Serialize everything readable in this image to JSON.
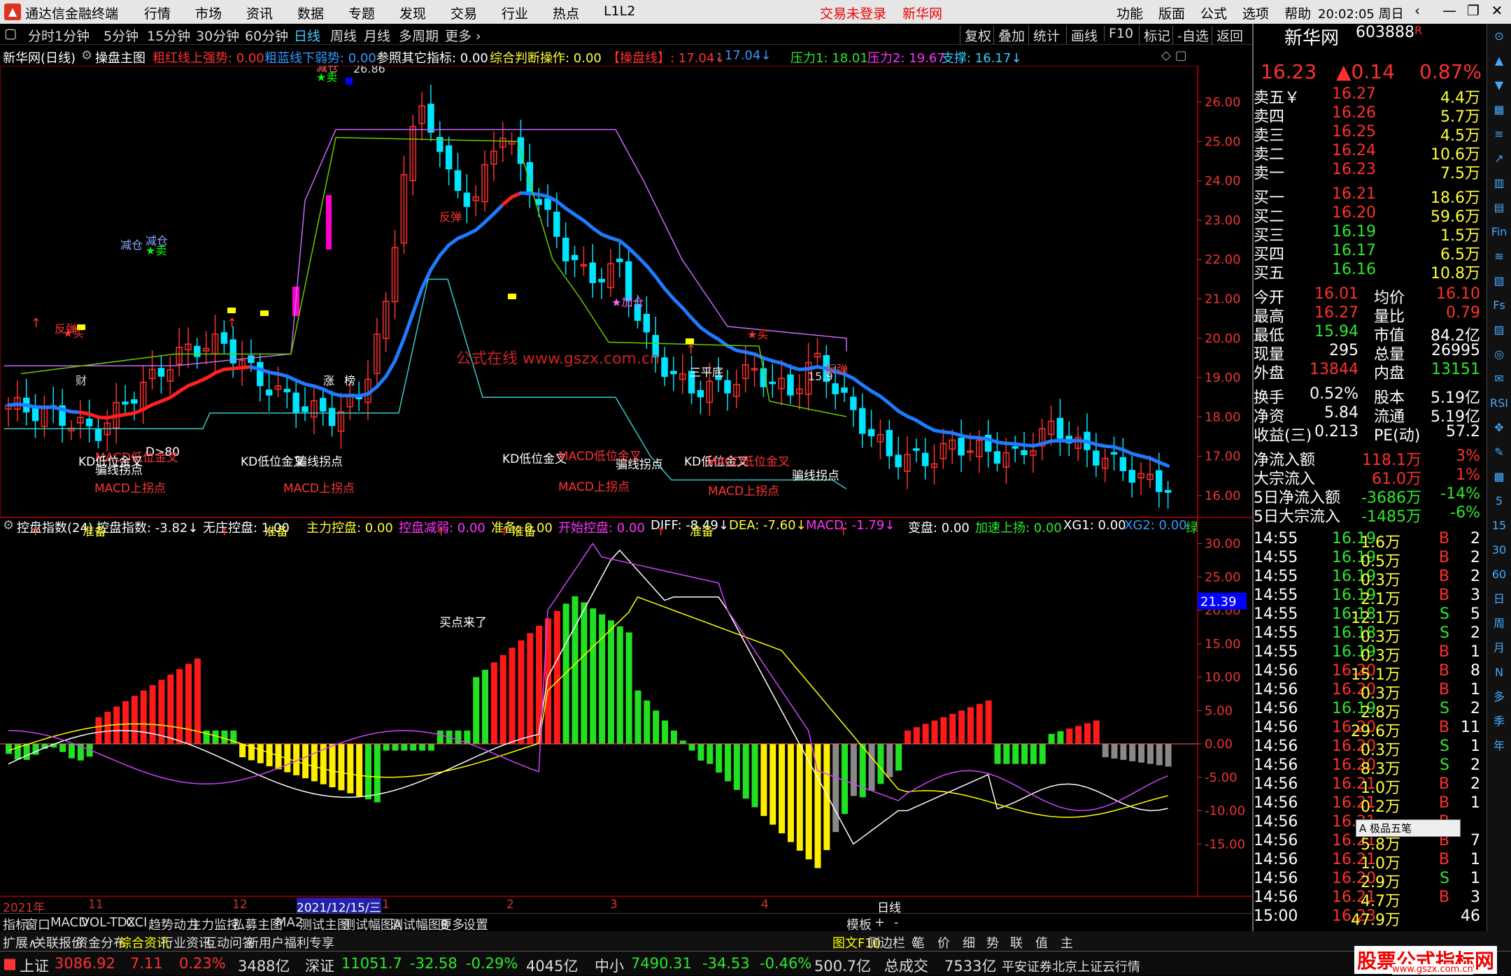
{
  "app": {
    "title": "通达信金融终端",
    "menu": [
      "行情",
      "市场",
      "资讯",
      "数据",
      "专题",
      "发现",
      "交易",
      "行业",
      "热点",
      "L1L2"
    ],
    "trade_status": "交易未登录",
    "corp": "新华网",
    "right_menu": [
      "功能",
      "版面",
      "公式",
      "选项",
      "帮助"
    ],
    "time": "20:02:05",
    "weekday": "周日",
    "win_buttons": [
      "‹",
      "—",
      "❐",
      "✕"
    ]
  },
  "period_bar": {
    "items": [
      "分时",
      "1分钟",
      "5分钟",
      "15分钟",
      "30分钟",
      "60分钟",
      "日线",
      "周线",
      "月线",
      "多周期",
      "更多 ›"
    ],
    "selected": "日线",
    "right_buttons": [
      "复权",
      "叠加",
      "统计",
      "画线",
      "F10",
      "标记",
      "-自选",
      "返回"
    ]
  },
  "main_header": {
    "stock": "新华网(日线)",
    "formula": "操盘主图",
    "items": [
      {
        "t": "粗红线上强势: 0.00",
        "c": "red"
      },
      {
        "t": "粗蓝线下弱势: 0.00",
        "c": "blu"
      },
      {
        "t": "参照其它指标: 0.00",
        "c": "wht"
      },
      {
        "t": "综合判断操作: 0.00",
        "c": "yel"
      },
      {
        "t": "【操盘线】: 17.04↓",
        "c": "red"
      },
      {
        "t": ": 17.04↓",
        "c": "blu"
      },
      {
        "t": "压力1: 18.01",
        "c": "grn"
      },
      {
        "t": "压力2: 19.67",
        "c": "mag"
      },
      {
        "t": "支撑: 16.17↓",
        "c": "cyan"
      }
    ]
  },
  "ind_header": {
    "name": "控盘指数(24)",
    "items": [
      {
        "t": "控盘指数: -3.82↓",
        "c": "wht"
      },
      {
        "t": "无庄控盘: 1.00",
        "c": "wht"
      },
      {
        "t": "主力控盘: 0.00",
        "c": "yel"
      },
      {
        "t": "控盘减弱: 0.00",
        "c": "mag"
      },
      {
        "t": "准备: 0.00",
        "c": "yel"
      },
      {
        "t": "开始控盘: 0.00",
        "c": "mag"
      },
      {
        "t": "DIFF: -8.49↓",
        "c": "wht"
      },
      {
        "t": "DEA: -7.60↓",
        "c": "yel"
      },
      {
        "t": "MACD: -1.79↓",
        "c": "mag"
      },
      {
        "t": "变盘: 0.00",
        "c": "wht"
      },
      {
        "t": "加速上扬: 0.00",
        "c": "grn"
      },
      {
        "t": "XG1: 0.00",
        "c": "wht"
      },
      {
        "t": "XG2: 0.00",
        "c": "blu"
      },
      {
        "t": "绿",
        "c": "grn"
      }
    ]
  },
  "price_axis": [
    "26.00",
    "25.00",
    "24.00",
    "23.00",
    "22.00",
    "21.00",
    "20.00",
    "19.00",
    "18.00",
    "17.00",
    "16.00"
  ],
  "ind_axis": [
    "30.00",
    "25.00",
    "20.00",
    "15.00",
    "10.00",
    "5.00",
    "0.00",
    "-5.00",
    "-10.00",
    "-15.00"
  ],
  "ind_current": "21.39",
  "price_annotations": [
    {
      "t": "减仓",
      "c": "#f66"
    },
    {
      "t": "★卖",
      "c": "#0f0"
    },
    {
      "t": "26.86",
      "c": "#ddd"
    },
    {
      "t": "减仓",
      "c": "#8af"
    },
    {
      "t": "减仓",
      "c": "#8af"
    },
    {
      "t": "★卖",
      "c": "#0f0"
    },
    {
      "t": "反弹",
      "c": "#f33"
    },
    {
      "t": "反弹",
      "c": "#f33"
    },
    {
      "t": "★买",
      "c": "#f33"
    },
    {
      "t": "★加仓",
      "c": "#f6f"
    },
    {
      "t": "★买",
      "c": "#f33"
    },
    {
      "t": "三平底",
      "c": "#fff"
    },
    {
      "t": "15.9",
      "c": "#ddd"
    },
    {
      "t": "反弹",
      "c": "#f33"
    },
    {
      "t": "财",
      "c": "#ddd"
    },
    {
      "t": "涨",
      "c": "#fff"
    },
    {
      "t": "榜",
      "c": "#fff"
    },
    {
      "t": "公式在线  www.gszx.com.cn",
      "c": "#c22"
    }
  ],
  "ind_annotations": [
    {
      "t": "D>80",
      "c": "#fff"
    },
    {
      "t": "MACD低位金叉",
      "c": "#f33"
    },
    {
      "t": "KD低位金叉",
      "c": "#fff"
    },
    {
      "t": "骗线拐点",
      "c": "#fff"
    },
    {
      "t": "MACD上拐点",
      "c": "#f33"
    },
    {
      "t": "准备",
      "c": "#ff3"
    },
    {
      "t": "KD低位金叉",
      "c": "#fff"
    },
    {
      "t": "骗线拐点",
      "c": "#fff"
    },
    {
      "t": "MACD上拐点",
      "c": "#f33"
    },
    {
      "t": "准备",
      "c": "#ff3"
    },
    {
      "t": "买点来了",
      "c": "#fff"
    },
    {
      "t": "KD低位金叉",
      "c": "#fff"
    },
    {
      "t": "MACD低位金叉",
      "c": "#f33"
    },
    {
      "t": "骗线拐点",
      "c": "#fff"
    },
    {
      "t": "MACD上拐点",
      "c": "#f33"
    },
    {
      "t": "准备",
      "c": "#ff3"
    },
    {
      "t": "KD低位金叉",
      "c": "#fff"
    },
    {
      "t": "MACD低位金叉",
      "c": "#f33"
    },
    {
      "t": "MACD上拐点",
      "c": "#f33"
    },
    {
      "t": "骗线拐点",
      "c": "#fff"
    },
    {
      "t": "准备",
      "c": "#ff3"
    }
  ],
  "x_axis": [
    "2021年",
    "11",
    "12",
    "2021/12/15/三",
    "1",
    "2",
    "3",
    "4",
    "日线"
  ],
  "tabs_bottom": [
    "指标",
    "窗口",
    "MACD",
    "VOL-TDX",
    "CCI",
    "趋势动力",
    "主力监控",
    "私募主图",
    "MA2",
    "测试主图",
    "测试幅图A",
    "测试幅图B",
    "更多",
    "设置",
    "模板",
    "+",
    "-"
  ],
  "tabs_info": [
    "扩展∧",
    "关联报价",
    "资金分布",
    "综合资讯",
    "行业资讯",
    "互动问答",
    "新用户福利专享",
    "图文F10",
    "侧边栏《",
    "笔",
    "价",
    "细",
    "势",
    "联",
    "值",
    "主"
  ],
  "status": {
    "sh_label": "上证",
    "sh_val": "3086.92",
    "sh_chg": "7.11",
    "sh_pct": "0.23%",
    "sh_amt": "3488亿",
    "sz_label": "深证",
    "sz_val": "11051.7",
    "sz_chg": "-32.58",
    "sz_pct": "-0.29%",
    "sz_amt": "4045亿",
    "zx_label": "中小",
    "zx_val": "7490.31",
    "zx_chg": "-34.53",
    "zx_pct": "-0.46%",
    "zx_amt": "500.7亿",
    "total_label": "总成交",
    "total_val": "7533亿",
    "server": "平安证券北京上证云行情",
    "logo": "股票公式指标网",
    "logo_url": "www.gszx.com.cn"
  },
  "quote": {
    "name": "新华网",
    "code": "603888",
    "flag": "R",
    "price": "16.23",
    "chg": "▲0.14",
    "pct": "0.87%",
    "asks": [
      {
        "l": "卖五￥",
        "p": "16.27",
        "v": "4.4万"
      },
      {
        "l": "卖四",
        "p": "16.26",
        "v": "5.7万"
      },
      {
        "l": "卖三",
        "p": "16.25",
        "v": "4.5万"
      },
      {
        "l": "卖二",
        "p": "16.24",
        "v": "10.6万"
      },
      {
        "l": "卖一",
        "p": "16.23",
        "v": "7.5万"
      }
    ],
    "bids": [
      {
        "l": "买一",
        "p": "16.21",
        "v": "18.6万"
      },
      {
        "l": "买二",
        "p": "16.20",
        "v": "59.6万"
      },
      {
        "l": "买三",
        "p": "16.19",
        "v": "1.5万"
      },
      {
        "l": "买四",
        "p": "16.17",
        "v": "6.5万"
      },
      {
        "l": "买五",
        "p": "16.16",
        "v": "10.8万"
      }
    ],
    "stats": [
      {
        "a": "今开",
        "b": "16.01",
        "ac": "red",
        "c": "均价",
        "d": "16.10",
        "dc": "red"
      },
      {
        "a": "最高",
        "b": "16.27",
        "ac": "red",
        "c": "量比",
        "d": "0.79",
        "dc": "red"
      },
      {
        "a": "最低",
        "b": "15.94",
        "ac": "grn",
        "c": "市值",
        "d": "84.2亿",
        "dc": "wht"
      },
      {
        "a": "现量",
        "b": "295",
        "ac": "wht",
        "c": "总量",
        "d": "26995",
        "dc": "wht"
      },
      {
        "a": "外盘",
        "b": "13844",
        "ac": "red",
        "c": "内盘",
        "d": "13151",
        "dc": "grn"
      }
    ],
    "stats2": [
      {
        "a": "换手",
        "b": "0.52%",
        "c": "股本",
        "d": "5.19亿"
      },
      {
        "a": "净资",
        "b": "5.84",
        "c": "流通",
        "d": "5.19亿"
      },
      {
        "a": "收益(三)",
        "b": "0.213",
        "c": "PE(动)",
        "d": "57.2"
      }
    ],
    "flows": [
      {
        "a": "净流入额",
        "b": "118.1万",
        "bc": "red",
        "c": "3%",
        "cc": "red"
      },
      {
        "a": "大宗流入",
        "b": "61.0万",
        "bc": "red",
        "c": "1%",
        "cc": "red"
      },
      {
        "a": "5日净流入额",
        "b": "-3686万",
        "bc": "grn",
        "c": "-14%",
        "cc": "grn"
      },
      {
        "a": "5日大宗流入",
        "b": "-1485万",
        "bc": "grn",
        "c": "-6%",
        "cc": "grn"
      }
    ],
    "ticks": [
      [
        "14:55",
        "16.19",
        "1.6万",
        "B",
        "2"
      ],
      [
        "14:55",
        "16.19",
        "0.5万",
        "B",
        "2"
      ],
      [
        "14:55",
        "16.19",
        "0.3万",
        "B",
        "2"
      ],
      [
        "14:55",
        "16.19",
        "2.1万",
        "B",
        "3"
      ],
      [
        "14:55",
        "16.18",
        "12.1万",
        "S",
        "5"
      ],
      [
        "14:55",
        "16.18",
        "0.3万",
        "S",
        "2"
      ],
      [
        "14:55",
        "16.19",
        "0.3万",
        "B",
        "1"
      ],
      [
        "14:56",
        "16.20",
        "15.1万",
        "B",
        "8"
      ],
      [
        "14:56",
        "16.20",
        "0.3万",
        "B",
        "1"
      ],
      [
        "14:56",
        "16.19",
        "2.8万",
        "S",
        "2"
      ],
      [
        "14:56",
        "16.20",
        "29.6万",
        "B",
        "11"
      ],
      [
        "14:56",
        "16.20",
        "0.3万",
        "S",
        "1"
      ],
      [
        "14:56",
        "16.20",
        "8.3万",
        "S",
        "2"
      ],
      [
        "14:56",
        "16.21",
        "1.0万",
        "B",
        "2"
      ],
      [
        "14:56",
        "16.21",
        "0.2万",
        "B",
        "1"
      ],
      [
        "14:56",
        "16.21",
        "",
        "B",
        ""
      ],
      [
        "14:56",
        "16.21",
        "5.8万",
        "B",
        "7"
      ],
      [
        "14:56",
        "16.21",
        "1.0万",
        "B",
        "1"
      ],
      [
        "14:56",
        "16.20",
        "2.9万",
        "S",
        "1"
      ],
      [
        "14:56",
        "16.21",
        "4.7万",
        "B",
        "3"
      ],
      [
        "15:00",
        "16.23",
        "47.9万",
        "",
        "46"
      ]
    ],
    "tool_popup": "A 极品五笔"
  },
  "sidebar_icons": [
    "⊙",
    "▲",
    "▼",
    "▦",
    "≡",
    "↗",
    "▥",
    "▤",
    "Fin",
    "≋",
    "▧",
    "Fs",
    "▨",
    "◎",
    "✉",
    "RSI",
    "✥",
    "✎",
    "▩",
    "5",
    "15",
    "30",
    "60",
    "日",
    "周",
    "月",
    "N",
    "多",
    "季",
    "年"
  ],
  "colors": {
    "up": "#ff3030",
    "down": "#00e5ff",
    "red": "#ff3030",
    "green": "#2ee82e"
  }
}
